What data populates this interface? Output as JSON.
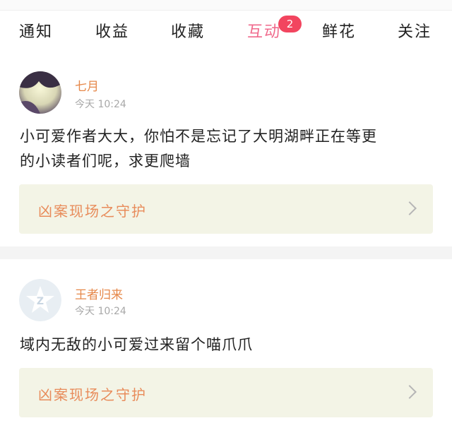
{
  "tabs": [
    {
      "label": "通知"
    },
    {
      "label": "收益"
    },
    {
      "label": "收藏"
    },
    {
      "label": "互动",
      "badge": "2"
    },
    {
      "label": "鲜花"
    },
    {
      "label": "关注"
    }
  ],
  "colors": {
    "accent": "#f06a8c",
    "badge": "#f2455f",
    "username": "#e6884a",
    "ref_bg": "#f3f4e6"
  },
  "posts": [
    {
      "username": "七月",
      "time": "今天 10:24",
      "content_line1": "小可爱作者大大，你怕不是忘记了大明湖畔正在等更",
      "content_line2": "的小读者们呢，求更爬墙",
      "ref_title": "凶案现场之守护"
    },
    {
      "username": "王者归来",
      "time": "今天 10:24",
      "content_line1": "域内无敌的小可爱过来留个喵爪爪",
      "ref_title": "凶案现场之守护"
    }
  ]
}
